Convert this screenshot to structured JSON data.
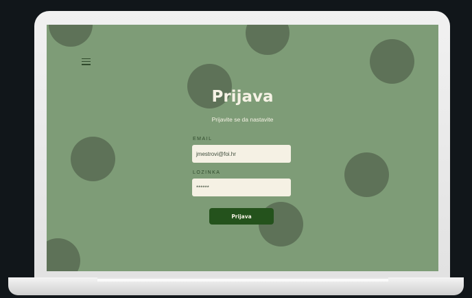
{
  "colors": {
    "screen_bg": "#7e9c77",
    "circle": "#5e7258",
    "title_text": "#f6f2e5",
    "label_text": "#2f4a2c",
    "field_bg": "#f5f1e4",
    "field_text": "#3b4a38",
    "button_bg": "#24521c",
    "button_text": "#f6f2e5"
  },
  "icons": {
    "menu": "hamburger-menu-icon"
  },
  "login": {
    "title": "Prijava",
    "subtitle": "Prijavite se da nastavite",
    "email_label": "EMAIL",
    "email_value": "jmestrovi@foi.hr",
    "password_label": "LOZINKA",
    "password_value": "******",
    "submit_label": "Prijava"
  }
}
